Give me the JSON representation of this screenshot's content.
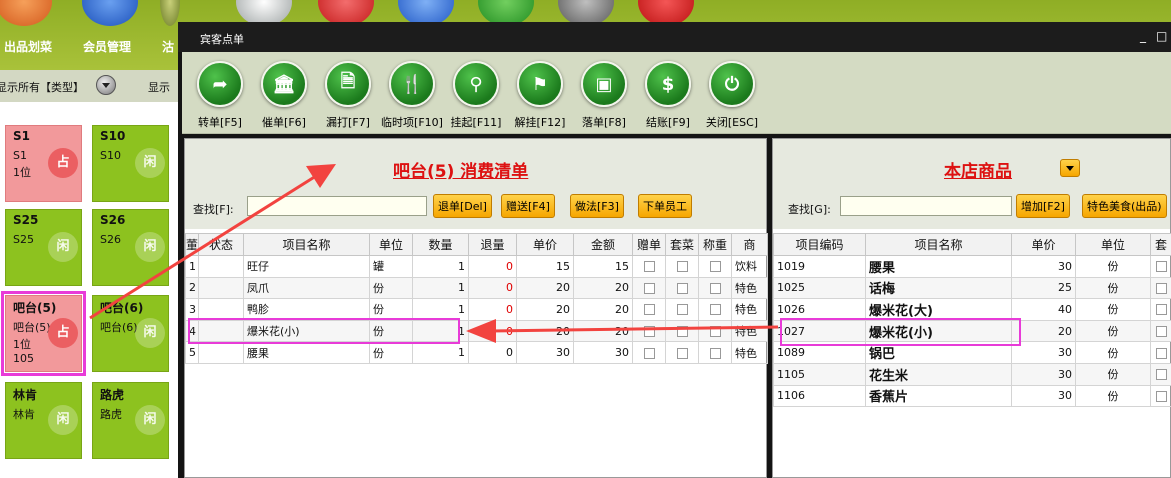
{
  "background_nav": {
    "items": [
      {
        "label": "出品划菜"
      },
      {
        "label": "会员管理"
      },
      {
        "label": "沽"
      }
    ]
  },
  "background_filter": {
    "show_all_type": "显示所有【类型】",
    "show_second": "显示"
  },
  "table_tiles": [
    {
      "name": "S1",
      "line1": "S1",
      "line2": "1位",
      "line3": "",
      "badge": "占",
      "occupied": true
    },
    {
      "name": "S10",
      "line1": "S10",
      "line2": "",
      "line3": "",
      "badge": "闲",
      "occupied": false
    },
    {
      "name": "S25",
      "line1": "S25",
      "line2": "",
      "line3": "",
      "badge": "闲",
      "occupied": false
    },
    {
      "name": "S26",
      "line1": "S26",
      "line2": "",
      "line3": "",
      "badge": "闲",
      "occupied": false
    },
    {
      "name": "吧台(5)",
      "line1": "吧台(5)",
      "line2": "1位",
      "line3": "105",
      "badge": "占",
      "occupied": true
    },
    {
      "name": "吧台(6)",
      "line1": "吧台(6)",
      "line2": "",
      "line3": "",
      "badge": "闲",
      "occupied": false
    },
    {
      "name": "林肯",
      "line1": "林肯",
      "line2": "",
      "line3": "",
      "badge": "闲",
      "occupied": false
    },
    {
      "name": "路虎",
      "line1": "路虎",
      "line2": "",
      "line3": "",
      "badge": "闲",
      "occupied": false
    }
  ],
  "window": {
    "title": "宾客点单",
    "minimize": "_",
    "restore": "□"
  },
  "toolbar": [
    {
      "label": "转单[F5]",
      "icon": "transfer-arrow-icon",
      "glyph": "➦"
    },
    {
      "label": "催单[F6]",
      "icon": "bank-icon",
      "glyph": "🏛"
    },
    {
      "label": "漏打[F7]",
      "icon": "document-icon",
      "glyph": "🗎"
    },
    {
      "label": "临时项[F10]",
      "icon": "cutlery-icon",
      "glyph": "🍴"
    },
    {
      "label": "挂起[F11]",
      "icon": "tie-hang-icon",
      "glyph": "⚲"
    },
    {
      "label": "解挂[F12]",
      "icon": "tie-icon",
      "glyph": "⚑"
    },
    {
      "label": "落单[F8]",
      "icon": "monitor-icon",
      "glyph": "▣"
    },
    {
      "label": "结账[F9]",
      "icon": "dollar-icon",
      "glyph": "$"
    },
    {
      "label": "关闭[ESC]",
      "icon": "power-icon",
      "glyph": "⏻"
    }
  ],
  "left_panel": {
    "title": "吧台(5) 消费清单",
    "search_label": "查找[F]:",
    "search_value": "",
    "buttons": [
      "退单[Del]",
      "赠送[F4]",
      "做法[F3]",
      "下单员工"
    ],
    "columns": [
      "董",
      "状态",
      "项目名称",
      "单位",
      "数量",
      "退量",
      "单价",
      "金额",
      "赠单",
      "套菜",
      "称重",
      "商"
    ],
    "rows": [
      {
        "no": "1",
        "status": "",
        "name": "旺仔",
        "unit": "罐",
        "qty": "1",
        "ret": "0",
        "price": "15",
        "amount": "15",
        "cat": "饮料"
      },
      {
        "no": "2",
        "status": "",
        "name": "凤爪",
        "unit": "份",
        "qty": "1",
        "ret": "0",
        "price": "20",
        "amount": "20",
        "cat": "特色"
      },
      {
        "no": "3",
        "status": "",
        "name": "鸭胗",
        "unit": "份",
        "qty": "1",
        "ret": "0",
        "price": "20",
        "amount": "20",
        "cat": "特色"
      },
      {
        "no": "4",
        "status": "",
        "name": "爆米花(小)",
        "unit": "份",
        "qty": "1",
        "ret": "0",
        "price": "20",
        "amount": "20",
        "cat": "特色"
      },
      {
        "no": "5",
        "status": "",
        "name": "腰果",
        "unit": "份",
        "qty": "1",
        "ret": "0",
        "price": "30",
        "amount": "30",
        "cat": "特色"
      }
    ]
  },
  "right_panel": {
    "title": "本店商品",
    "search_label": "查找[G]:",
    "search_value": "",
    "buttons": [
      "增加[F2]",
      "特色美食(出品)"
    ],
    "columns": [
      "项目编码",
      "项目名称",
      "单价",
      "单位",
      "套"
    ],
    "rows": [
      {
        "code": "1019",
        "name": "腰果",
        "price": "30",
        "unit": "份"
      },
      {
        "code": "1025",
        "name": "话梅",
        "price": "25",
        "unit": "份"
      },
      {
        "code": "1026",
        "name": "爆米花(大)",
        "price": "40",
        "unit": "份"
      },
      {
        "code": "1027",
        "name": "爆米花(小)",
        "price": "20",
        "unit": "份"
      },
      {
        "code": "1089",
        "name": "锅巴",
        "price": "30",
        "unit": "份"
      },
      {
        "code": "1105",
        "name": "花生米",
        "price": "30",
        "unit": "份"
      },
      {
        "code": "1106",
        "name": "香蕉片",
        "price": "30",
        "unit": "份"
      }
    ]
  },
  "colors": {
    "accent_green": "#8dc21f",
    "occupied_pink": "#f2999b",
    "highlight_magenta": "#e83bd8",
    "arrow_red": "#f2433f",
    "title_red": "#dd1111",
    "button_orange": "#f6a600"
  }
}
